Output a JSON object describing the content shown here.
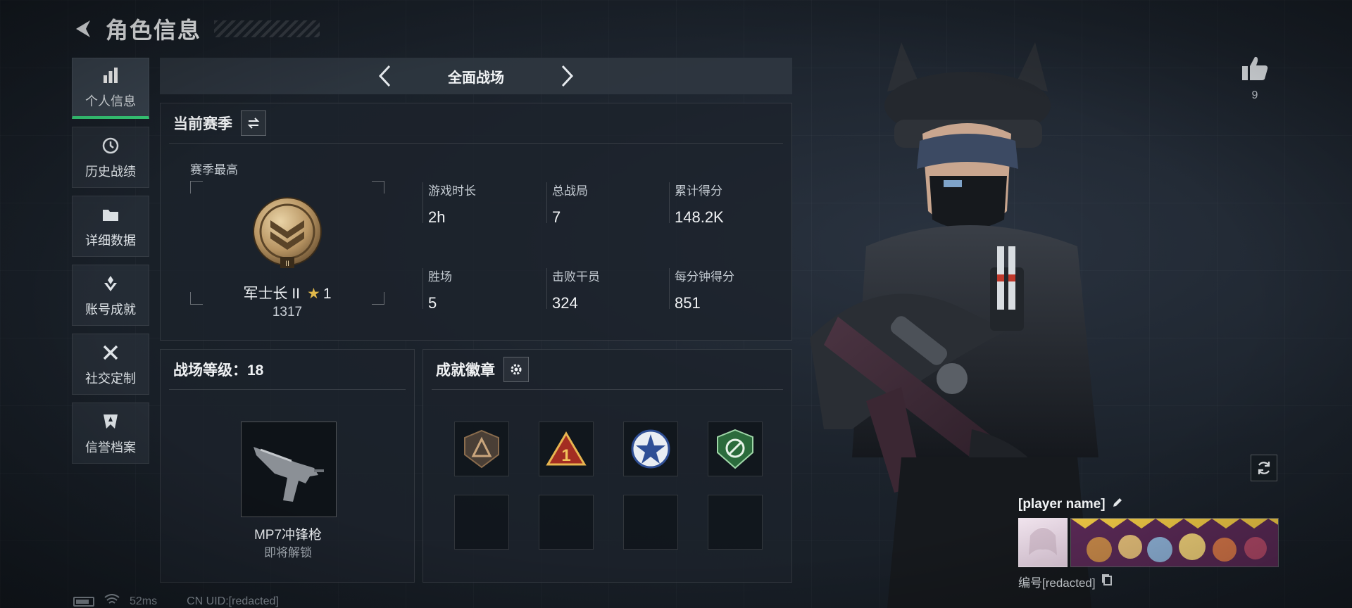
{
  "header": {
    "title": "角色信息"
  },
  "sidebar": {
    "items": [
      {
        "label": "个人信息",
        "icon": "bar-chart-icon",
        "active": true
      },
      {
        "label": "历史战绩",
        "icon": "history-icon",
        "active": false
      },
      {
        "label": "详细数据",
        "icon": "folder-icon",
        "active": false
      },
      {
        "label": "账号成就",
        "icon": "achievement-icon",
        "active": false
      },
      {
        "label": "社交定制",
        "icon": "wrench-icon",
        "active": false
      },
      {
        "label": "信誉档案",
        "icon": "shield-icon",
        "active": false
      }
    ]
  },
  "mode": {
    "title": "全面战场"
  },
  "season": {
    "title": "当前赛季",
    "best_label": "赛季最高",
    "rank_name": "军士长 II",
    "rank_stars": "1",
    "rank_score": "1317",
    "stats": [
      {
        "label": "游戏时长",
        "value": "2h"
      },
      {
        "label": "总战局",
        "value": "7"
      },
      {
        "label": "累计得分",
        "value": "148.2K"
      },
      {
        "label": "胜场",
        "value": "5"
      },
      {
        "label": "击败干员",
        "value": "324"
      },
      {
        "label": "每分钟得分",
        "value": "851"
      }
    ]
  },
  "level": {
    "title": "战场等级：18",
    "weapon_name": "MP7冲锋枪",
    "weapon_status": "即将解锁"
  },
  "badges": {
    "title": "成就徽章",
    "slots": [
      "bronze-triangle-badge",
      "red-number-one-badge",
      "blue-star-badge",
      "green-crest-badge",
      "",
      "",
      "",
      ""
    ]
  },
  "status_bar": {
    "ping": "52ms",
    "uid": "CN UID:[redacted]"
  },
  "social": {
    "like_count": "9"
  },
  "player": {
    "name": "[player name]",
    "id_text": "编号[redacted]"
  },
  "colors": {
    "accent": "#38d07a",
    "star": "#e0b84a"
  }
}
